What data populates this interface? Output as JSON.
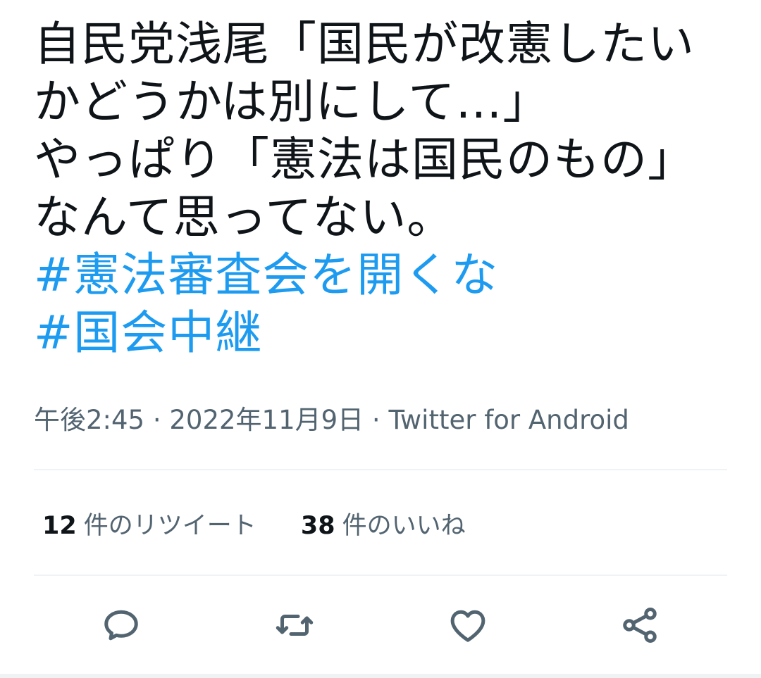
{
  "tweet": {
    "lines": [
      "自民党浅尾「国民が改憲したい",
      "かどうかは別にして…」",
      "やっぱり「憲法は国民のもの」",
      "なんて思ってない。"
    ],
    "hashtags": [
      "#憲法審査会を開くな",
      "#国会中継"
    ]
  },
  "meta": {
    "text": "午後2:45 · 2022年11月9日 · Twitter for Android"
  },
  "stats": {
    "retweets": {
      "count": "12",
      "label": "件のリツイート"
    },
    "likes": {
      "count": "38",
      "label": "件のいいね"
    }
  },
  "actions": [
    {
      "icon": "reply-icon"
    },
    {
      "icon": "retweet-icon"
    },
    {
      "icon": "like-icon"
    },
    {
      "icon": "share-icon"
    }
  ],
  "colors": {
    "hashtag": "#1d9bf0",
    "text": "#0f1419",
    "muted": "#536471",
    "divider": "#eff3f4"
  }
}
